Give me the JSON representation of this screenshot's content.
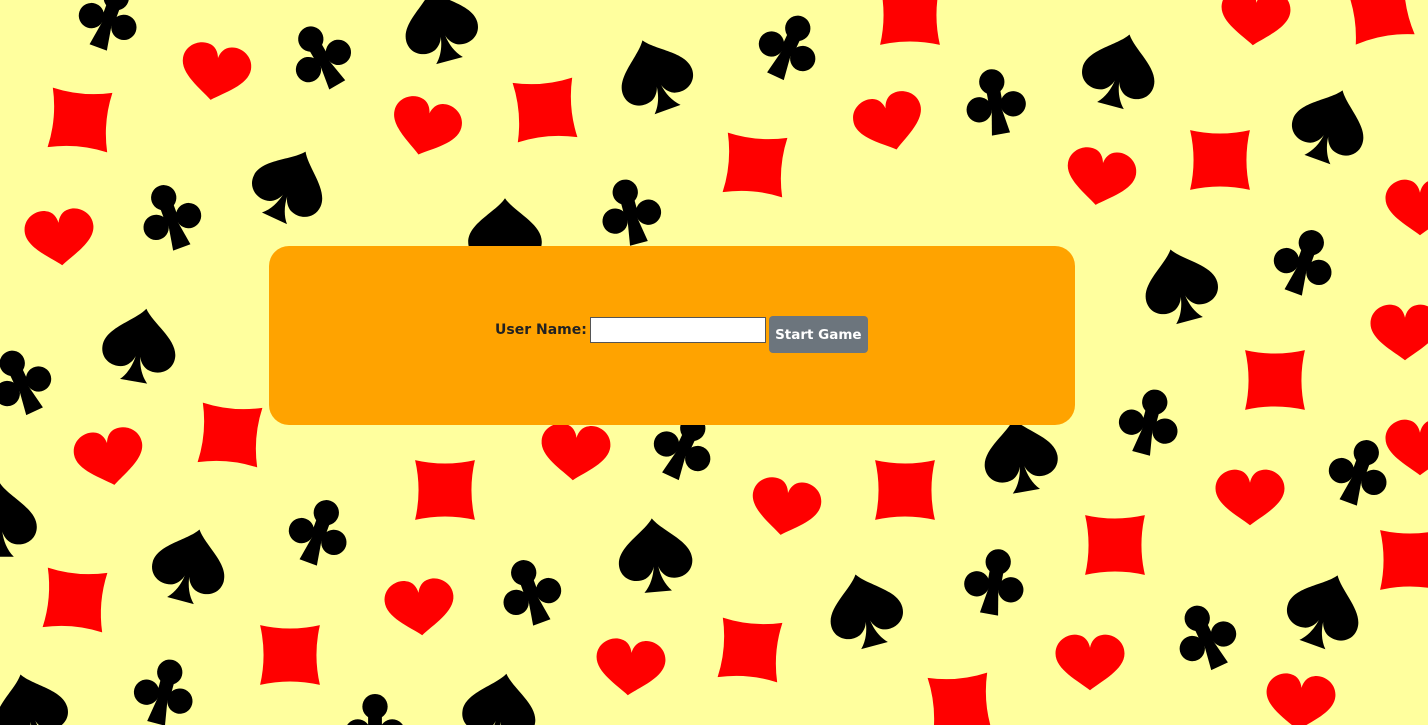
{
  "login": {
    "username_label": "User Name:",
    "username_value": "",
    "username_placeholder": "",
    "start_button_label": "Start Game"
  },
  "colors": {
    "background": "#ffff9e",
    "panel": "#ffa300",
    "button": "#6c757d",
    "red_suit": "#ff0000",
    "black_suit": "#000000"
  },
  "background_pattern": {
    "icons": [
      "heart-icon",
      "diamond-icon",
      "spade-icon",
      "club-icon"
    ]
  }
}
